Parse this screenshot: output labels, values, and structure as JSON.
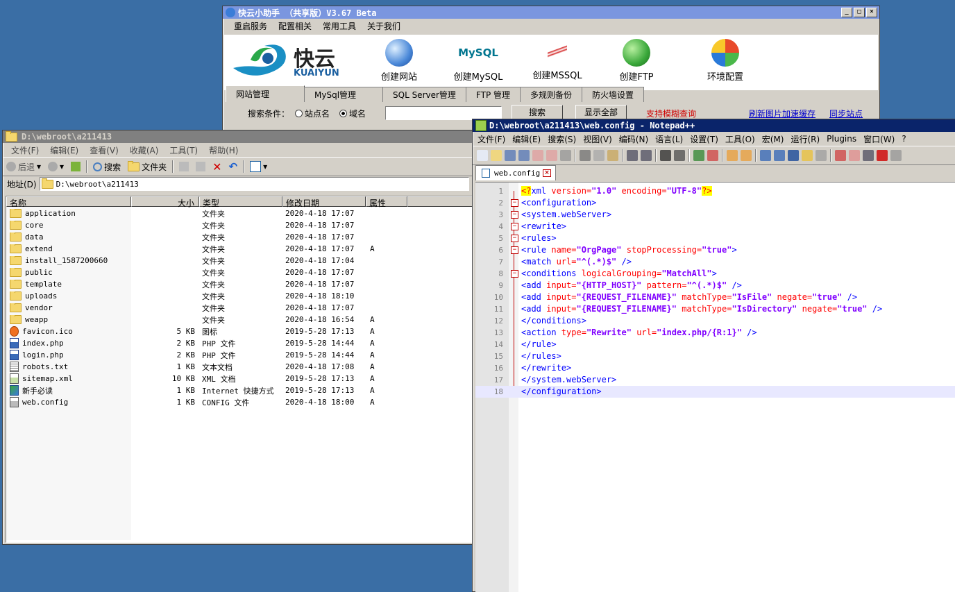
{
  "kuaiyun": {
    "title": "快云小助手 （共享版）V3.67 Beta",
    "menu": [
      "重启服务",
      "配置相关",
      "常用工具",
      "关于我们"
    ],
    "logo_text": "快云",
    "logo_sub": "KUAIYUN",
    "tools": [
      {
        "label": "创建网站",
        "icon": "globe-icon"
      },
      {
        "label": "创建MySQL",
        "icon": "mysql-icon"
      },
      {
        "label": "创建MSSQL",
        "icon": "sqlserver-icon"
      },
      {
        "label": "创建FTP",
        "icon": "ftp-icon"
      },
      {
        "label": "环境配置",
        "icon": "windows-icon"
      }
    ],
    "tabs": [
      "网站管理",
      "MySql管理",
      "SQL Server管理",
      "FTP 管理",
      "多规则备份",
      "防火墙设置"
    ],
    "search_label": "搜索条件：",
    "radio_site": "站点名",
    "radio_domain": "域名",
    "search_btn": "搜索",
    "show_all_btn": "显示全部",
    "fuzzy_text": "支持模糊查询",
    "link_refresh": "刷新图片加速缓存",
    "link_sync": "同步站点",
    "colors": {
      "fuzzy": "#d00000",
      "link": "#0000cc"
    }
  },
  "explorer": {
    "title": "D:\\webroot\\a211413",
    "menu": [
      "文件(F)",
      "编辑(E)",
      "查看(V)",
      "收藏(A)",
      "工具(T)",
      "帮助(H)"
    ],
    "toolbar": {
      "back": "后退",
      "search": "搜索",
      "folders": "文件夹"
    },
    "address_label": "地址(D)",
    "address": "D:\\webroot\\a211413",
    "columns": [
      "名称",
      "大小",
      "类型",
      "修改日期",
      "属性"
    ],
    "files": [
      {
        "name": "application",
        "size": "",
        "type": "文件夹",
        "date": "2020-4-18 17:07",
        "attr": "",
        "icon": "folder"
      },
      {
        "name": "core",
        "size": "",
        "type": "文件夹",
        "date": "2020-4-18 17:07",
        "attr": "",
        "icon": "folder"
      },
      {
        "name": "data",
        "size": "",
        "type": "文件夹",
        "date": "2020-4-18 17:07",
        "attr": "",
        "icon": "folder"
      },
      {
        "name": "extend",
        "size": "",
        "type": "文件夹",
        "date": "2020-4-18 17:07",
        "attr": "A",
        "icon": "folder"
      },
      {
        "name": "install_1587200660",
        "size": "",
        "type": "文件夹",
        "date": "2020-4-18 17:04",
        "attr": "",
        "icon": "folder"
      },
      {
        "name": "public",
        "size": "",
        "type": "文件夹",
        "date": "2020-4-18 17:07",
        "attr": "",
        "icon": "folder"
      },
      {
        "name": "template",
        "size": "",
        "type": "文件夹",
        "date": "2020-4-18 17:07",
        "attr": "",
        "icon": "folder"
      },
      {
        "name": "uploads",
        "size": "",
        "type": "文件夹",
        "date": "2020-4-18 18:10",
        "attr": "",
        "icon": "folder"
      },
      {
        "name": "vendor",
        "size": "",
        "type": "文件夹",
        "date": "2020-4-18 17:07",
        "attr": "",
        "icon": "folder"
      },
      {
        "name": "weapp",
        "size": "",
        "type": "文件夹",
        "date": "2020-4-18 16:54",
        "attr": "A",
        "icon": "folder"
      },
      {
        "name": "favicon.ico",
        "size": "5 KB",
        "type": "图标",
        "date": "2019-5-28 17:13",
        "attr": "A",
        "icon": "ico-file"
      },
      {
        "name": "index.php",
        "size": "2 KB",
        "type": "PHP 文件",
        "date": "2019-5-28 14:44",
        "attr": "A",
        "icon": "php-file"
      },
      {
        "name": "login.php",
        "size": "2 KB",
        "type": "PHP 文件",
        "date": "2019-5-28 14:44",
        "attr": "A",
        "icon": "php-file"
      },
      {
        "name": "robots.txt",
        "size": "1 KB",
        "type": "文本文档",
        "date": "2020-4-18 17:08",
        "attr": "A",
        "icon": "txt-file"
      },
      {
        "name": "sitemap.xml",
        "size": "10 KB",
        "type": "XML 文档",
        "date": "2019-5-28 17:13",
        "attr": "A",
        "icon": "xml-file"
      },
      {
        "name": "新手必读",
        "size": "1 KB",
        "type": "Internet 快捷方式",
        "date": "2019-5-28 17:13",
        "attr": "A",
        "icon": "url-file"
      },
      {
        "name": "web.config",
        "size": "1 KB",
        "type": "CONFIG 文件",
        "date": "2020-4-18 18:00",
        "attr": "A",
        "icon": "config-file"
      }
    ]
  },
  "notepad": {
    "title": "D:\\webroot\\a211413\\web.config - Notepad++",
    "menu": [
      "文件(F)",
      "编辑(E)",
      "搜索(S)",
      "视图(V)",
      "编码(N)",
      "语言(L)",
      "设置(T)",
      "工具(O)",
      "宏(M)",
      "运行(R)",
      "Plugins",
      "窗口(W)",
      "?"
    ],
    "tab": "web.config",
    "lines": [
      "<?xml version=\"1.0\" encoding=\"UTF-8\"?>",
      "<configuration>",
      "<system.webServer>",
      "<rewrite>",
      "<rules>",
      "<rule name=\"OrgPage\" stopProcessing=\"true\">",
      "<match url=\"^(.*)$\" />",
      "<conditions logicalGrouping=\"MatchAll\">",
      "<add input=\"{HTTP_HOST}\" pattern=\"^(.*)$\" />",
      "<add input=\"{REQUEST_FILENAME}\" matchType=\"IsFile\" negate=\"true\" />",
      "<add input=\"{REQUEST_FILENAME}\" matchType=\"IsDirectory\" negate=\"true\" />",
      "</conditions>",
      "<action type=\"Rewrite\" url=\"index.php/{R:1}\" />",
      "</rule>",
      "</rules>",
      "</rewrite>",
      "</system.webServer>",
      "</configuration>"
    ],
    "fold_markers": [
      2,
      3,
      4,
      5,
      6,
      8
    ]
  }
}
